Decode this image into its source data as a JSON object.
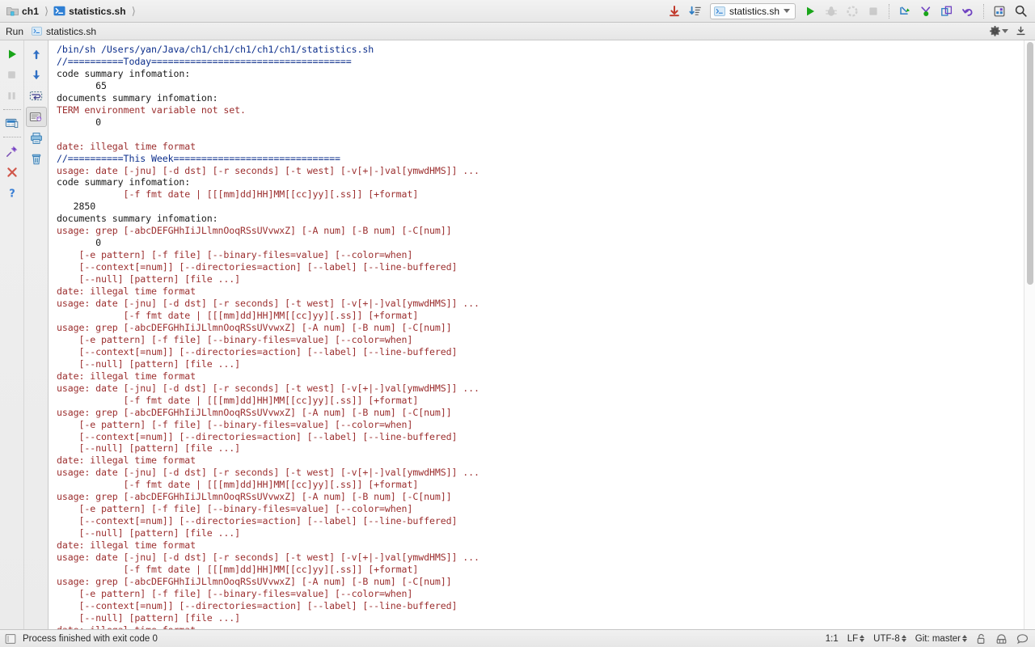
{
  "window": {
    "breadcrumb": [
      {
        "label": "ch1",
        "icon": "folder-icon"
      },
      {
        "label": "statistics.sh",
        "icon": "shell-script-icon"
      }
    ]
  },
  "toolbar": {
    "buttons": [
      {
        "name": "download-updates-button",
        "icon": "download-arrow-icon",
        "title": "Update"
      },
      {
        "name": "sort-changes-button",
        "icon": "download-sort-icon",
        "title": "Sort"
      }
    ],
    "run_configuration": {
      "label": "statistics.sh",
      "icon": "shell-script-icon",
      "dropdown_icon": "chevron-down-icon"
    },
    "run_button": {
      "name": "run-button",
      "icon": "play-icon",
      "enabled": true
    },
    "debug_button": {
      "name": "debug-button",
      "icon": "bug-icon",
      "enabled": false
    },
    "coverage_button": {
      "name": "run-coverage-button",
      "icon": "coverage-icon",
      "enabled": false
    },
    "stop_button": {
      "name": "stop-button",
      "icon": "stop-square-icon",
      "enabled": false
    },
    "vcs_buttons": [
      {
        "name": "vcs-update-project-button",
        "icon": "vcs-update-icon"
      },
      {
        "name": "vcs-commit-button",
        "icon": "vcs-commit-icon"
      },
      {
        "name": "vcs-compare-button",
        "icon": "vcs-compare-icon"
      },
      {
        "name": "vcs-rollback-button",
        "icon": "undo-arrow-icon"
      }
    ],
    "right_buttons": [
      {
        "name": "layout-settings-button",
        "icon": "layout-grid-icon"
      },
      {
        "name": "search-everywhere-button",
        "icon": "search-icon"
      }
    ]
  },
  "run_panel": {
    "title": "Run",
    "tab": {
      "label": "statistics.sh",
      "icon": "shell-script-icon"
    },
    "settings_button": {
      "name": "run-settings-button",
      "icon": "gear-icon",
      "dropdown_icon": "chevron-down-icon"
    },
    "hide_button": {
      "name": "hide-panel-button",
      "icon": "hide-down-icon"
    },
    "left_toolbar": [
      {
        "name": "rerun-button",
        "icon": "play-green-icon",
        "enabled": true
      },
      {
        "name": "stop-process-button",
        "icon": "stop-square-icon",
        "enabled": false
      },
      {
        "name": "pause-output-button",
        "icon": "pause-icon",
        "enabled": false
      },
      {
        "name": "dump-threads-button",
        "icon": "threads-dump-icon",
        "enabled": true
      },
      {
        "name": "pin-tab-button",
        "icon": "pin-icon",
        "enabled": true
      },
      {
        "name": "close-tab-button",
        "icon": "close-x-icon",
        "enabled": true
      },
      {
        "name": "help-button",
        "icon": "question-mark-icon",
        "enabled": true
      }
    ],
    "right_toolbar": [
      {
        "name": "scroll-up-button",
        "icon": "arrow-up-icon",
        "enabled": true
      },
      {
        "name": "scroll-down-button",
        "icon": "arrow-down-icon",
        "enabled": true
      },
      {
        "name": "soft-wrap-button",
        "icon": "soft-wrap-icon",
        "enabled": true
      },
      {
        "name": "scroll-to-end-button",
        "icon": "scroll-to-end-icon",
        "enabled": true,
        "selected": true
      },
      {
        "name": "print-button",
        "icon": "printer-icon",
        "enabled": true
      },
      {
        "name": "clear-all-button",
        "icon": "trash-icon",
        "enabled": true
      }
    ]
  },
  "console": {
    "lines": [
      {
        "text": "/bin/sh /Users/yan/Java/ch1/ch1/ch1/ch1/ch1/statistics.sh",
        "color": "blue"
      },
      {
        "text": "//==========Today====================================",
        "color": "blue"
      },
      {
        "text": "code summary infomation:",
        "color": "black"
      },
      {
        "text": "       65",
        "color": "black"
      },
      {
        "text": "documents summary infomation:",
        "color": "black"
      },
      {
        "text": "TERM environment variable not set.",
        "color": "red"
      },
      {
        "text": "       0",
        "color": "black"
      },
      {
        "text": "",
        "color": "black"
      },
      {
        "text": "date: illegal time format",
        "color": "red"
      },
      {
        "text": "//==========This Week==============================",
        "color": "blue"
      },
      {
        "text": "usage: date [-jnu] [-d dst] [-r seconds] [-t west] [-v[+|-]val[ymwdHMS]] ...",
        "color": "red"
      },
      {
        "text": "code summary infomation:",
        "color": "black"
      },
      {
        "text": "            [-f fmt date | [[[mm]dd]HH]MM[[cc]yy][.ss]] [+format]",
        "color": "red"
      },
      {
        "text": "   2850",
        "color": "black"
      },
      {
        "text": "documents summary infomation:",
        "color": "black"
      },
      {
        "text": "usage: grep [-abcDEFGHhIiJLlmnOoqRSsUVvwxZ] [-A num] [-B num] [-C[num]]",
        "color": "red"
      },
      {
        "text": "       0",
        "color": "black"
      },
      {
        "text": "    [-e pattern] [-f file] [--binary-files=value] [--color=when]",
        "color": "red"
      },
      {
        "text": "    [--context[=num]] [--directories=action] [--label] [--line-buffered]",
        "color": "red"
      },
      {
        "text": "    [--null] [pattern] [file ...]",
        "color": "red"
      },
      {
        "text": "date: illegal time format",
        "color": "red"
      },
      {
        "text": "usage: date [-jnu] [-d dst] [-r seconds] [-t west] [-v[+|-]val[ymwdHMS]] ...",
        "color": "red"
      },
      {
        "text": "            [-f fmt date | [[[mm]dd]HH]MM[[cc]yy][.ss]] [+format]",
        "color": "red"
      },
      {
        "text": "usage: grep [-abcDEFGHhIiJLlmnOoqRSsUVvwxZ] [-A num] [-B num] [-C[num]]",
        "color": "red"
      },
      {
        "text": "    [-e pattern] [-f file] [--binary-files=value] [--color=when]",
        "color": "red"
      },
      {
        "text": "    [--context[=num]] [--directories=action] [--label] [--line-buffered]",
        "color": "red"
      },
      {
        "text": "    [--null] [pattern] [file ...]",
        "color": "red"
      },
      {
        "text": "date: illegal time format",
        "color": "red"
      },
      {
        "text": "usage: date [-jnu] [-d dst] [-r seconds] [-t west] [-v[+|-]val[ymwdHMS]] ...",
        "color": "red"
      },
      {
        "text": "            [-f fmt date | [[[mm]dd]HH]MM[[cc]yy][.ss]] [+format]",
        "color": "red"
      },
      {
        "text": "usage: grep [-abcDEFGHhIiJLlmnOoqRSsUVvwxZ] [-A num] [-B num] [-C[num]]",
        "color": "red"
      },
      {
        "text": "    [-e pattern] [-f file] [--binary-files=value] [--color=when]",
        "color": "red"
      },
      {
        "text": "    [--context[=num]] [--directories=action] [--label] [--line-buffered]",
        "color": "red"
      },
      {
        "text": "    [--null] [pattern] [file ...]",
        "color": "red"
      },
      {
        "text": "date: illegal time format",
        "color": "red"
      },
      {
        "text": "usage: date [-jnu] [-d dst] [-r seconds] [-t west] [-v[+|-]val[ymwdHMS]] ...",
        "color": "red"
      },
      {
        "text": "            [-f fmt date | [[[mm]dd]HH]MM[[cc]yy][.ss]] [+format]",
        "color": "red"
      },
      {
        "text": "usage: grep [-abcDEFGHhIiJLlmnOoqRSsUVvwxZ] [-A num] [-B num] [-C[num]]",
        "color": "red"
      },
      {
        "text": "    [-e pattern] [-f file] [--binary-files=value] [--color=when]",
        "color": "red"
      },
      {
        "text": "    [--context[=num]] [--directories=action] [--label] [--line-buffered]",
        "color": "red"
      },
      {
        "text": "    [--null] [pattern] [file ...]",
        "color": "red"
      },
      {
        "text": "date: illegal time format",
        "color": "red"
      },
      {
        "text": "usage: date [-jnu] [-d dst] [-r seconds] [-t west] [-v[+|-]val[ymwdHMS]] ...",
        "color": "red"
      },
      {
        "text": "            [-f fmt date | [[[mm]dd]HH]MM[[cc]yy][.ss]] [+format]",
        "color": "red"
      },
      {
        "text": "usage: grep [-abcDEFGHhIiJLlmnOoqRSsUVvwxZ] [-A num] [-B num] [-C[num]]",
        "color": "red"
      },
      {
        "text": "    [-e pattern] [-f file] [--binary-files=value] [--color=when]",
        "color": "red"
      },
      {
        "text": "    [--context[=num]] [--directories=action] [--label] [--line-buffered]",
        "color": "red"
      },
      {
        "text": "    [--null] [pattern] [file ...]",
        "color": "red"
      },
      {
        "text": "date: illegal time format",
        "color": "red"
      }
    ]
  },
  "statusbar": {
    "process_message": "Process finished with exit code 0",
    "caret_position": "1:1",
    "line_separator": "LF",
    "encoding": "UTF-8",
    "branch": "Git: master",
    "icons": [
      {
        "name": "readonly-lock-icon"
      },
      {
        "name": "inspection-hector-icon"
      },
      {
        "name": "event-log-balloon-icon"
      }
    ],
    "left_icon": "terminal-toggle-icon"
  },
  "colors": {
    "console_blue": "#0d2f8c",
    "console_red": "#9c2f2f",
    "console_black": "#1a1a1a",
    "chrome_bg": "#ececec",
    "accent_green": "#36a836",
    "accent_blue": "#3a7fd5"
  }
}
